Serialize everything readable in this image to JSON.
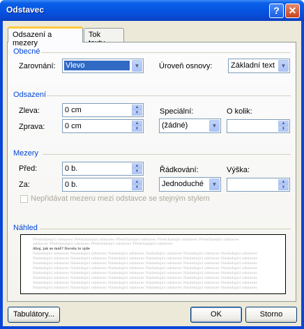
{
  "window": {
    "title": "Odstavec",
    "help_label": "?",
    "close_label": "✕"
  },
  "tabs": [
    {
      "label": "Odsazení a mezery",
      "active": true
    },
    {
      "label": "Tok textu",
      "active": false
    }
  ],
  "general": {
    "heading": "Obecné",
    "alignment_label": "Zarovnání:",
    "alignment_value": "Vlevo",
    "outline_label": "Úroveň osnovy:",
    "outline_value": "Základní text"
  },
  "indent": {
    "heading": "Odsazení",
    "left_label": "Zleva:",
    "left_value": "0 cm",
    "right_label": "Zprava:",
    "right_value": "0 cm",
    "special_label": "Speciální:",
    "special_value": "(žádné)",
    "by_label": "O kolik:",
    "by_value": ""
  },
  "spacing": {
    "heading": "Mezery",
    "before_label": "Před:",
    "before_value": "0 b.",
    "after_label": "Za:",
    "after_value": "0 b.",
    "line_spacing_label": "Řádkování:",
    "line_spacing_value": "Jednoduché",
    "at_label": "Výška:",
    "at_value": "",
    "dont_add_label": "Nepřidávat mezeru mezi odstavce se stejným stylem",
    "dont_add_checked": false
  },
  "preview": {
    "heading": "Náhled",
    "prev_line_1": "Předcházející odstavec Předcházející odstavec Předcházející odstavec Předcházející odstavec Předcházející odstavec",
    "prev_line_2": "odstavec Předcházející odstavec Předcházející odstavec Předcházející odstavec",
    "current_line": "Ahoj, jak se máš? Docela to ujde",
    "next_line": "Následující odstavec Následující odstavec Následující odstavec Následující odstavec Následující odstavec Následující odstavec"
  },
  "buttons": {
    "tabs_label": "Tabulátory...",
    "ok_label": "OK",
    "cancel_label": "Storno"
  },
  "colors": {
    "titlebar": "#0553e0",
    "section_heading": "#0046d5",
    "selection": "#316ac5"
  }
}
